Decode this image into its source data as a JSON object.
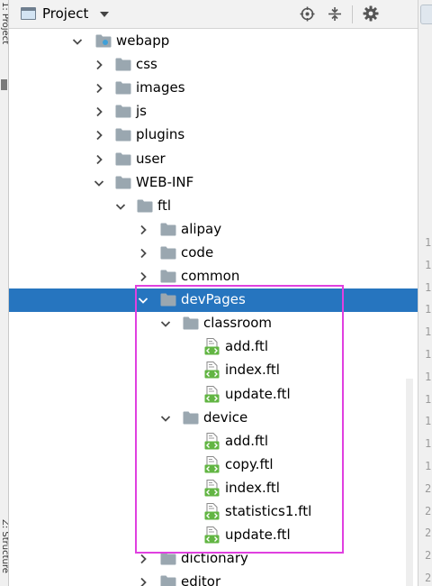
{
  "left_strip": {
    "top_label": "1: Project",
    "bottom_label": "Z: Structure"
  },
  "header": {
    "title": "Project",
    "icons": [
      "project-window-icon",
      "chevron-down-icon",
      "locate-icon",
      "collapse-all-icon",
      "gear-icon"
    ]
  },
  "gutter": {
    "line_numbers": [
      "1",
      "1",
      "1",
      "1",
      "1",
      "1",
      "1",
      "1",
      "1",
      "1",
      "1",
      "2",
      "2",
      "2",
      "2",
      "2"
    ]
  },
  "tree": [
    {
      "label": "webapp",
      "depth": 0,
      "type": "webfolder",
      "state": "open"
    },
    {
      "label": "css",
      "depth": 1,
      "type": "folder",
      "state": "closed"
    },
    {
      "label": "images",
      "depth": 1,
      "type": "folder",
      "state": "closed"
    },
    {
      "label": "js",
      "depth": 1,
      "type": "folder",
      "state": "closed"
    },
    {
      "label": "plugins",
      "depth": 1,
      "type": "folder",
      "state": "closed"
    },
    {
      "label": "user",
      "depth": 1,
      "type": "folder",
      "state": "closed"
    },
    {
      "label": "WEB-INF",
      "depth": 1,
      "type": "folder",
      "state": "open"
    },
    {
      "label": "ftl",
      "depth": 2,
      "type": "folder",
      "state": "open"
    },
    {
      "label": "alipay",
      "depth": 3,
      "type": "folder",
      "state": "closed"
    },
    {
      "label": "code",
      "depth": 3,
      "type": "folder",
      "state": "closed"
    },
    {
      "label": "common",
      "depth": 3,
      "type": "folder",
      "state": "closed"
    },
    {
      "label": "devPages",
      "depth": 3,
      "type": "folder",
      "state": "open",
      "selected": true
    },
    {
      "label": "classroom",
      "depth": 4,
      "type": "folder",
      "state": "open"
    },
    {
      "label": "add.ftl",
      "depth": 5,
      "type": "file"
    },
    {
      "label": "index.ftl",
      "depth": 5,
      "type": "file"
    },
    {
      "label": "update.ftl",
      "depth": 5,
      "type": "file"
    },
    {
      "label": "device",
      "depth": 4,
      "type": "folder",
      "state": "open"
    },
    {
      "label": "add.ftl",
      "depth": 5,
      "type": "file"
    },
    {
      "label": "copy.ftl",
      "depth": 5,
      "type": "file"
    },
    {
      "label": "index.ftl",
      "depth": 5,
      "type": "file"
    },
    {
      "label": "statistics1.ftl",
      "depth": 5,
      "type": "file"
    },
    {
      "label": "update.ftl",
      "depth": 5,
      "type": "file"
    },
    {
      "label": "dictionary",
      "depth": 3,
      "type": "folder",
      "state": "closed"
    },
    {
      "label": "editor",
      "depth": 3,
      "type": "folder",
      "state": "closed"
    }
  ],
  "colors": {
    "selection": "#2675bf",
    "highlight_box": "#e040e0",
    "folder": "#9aa7b0",
    "ftl_file": "#62b543"
  }
}
